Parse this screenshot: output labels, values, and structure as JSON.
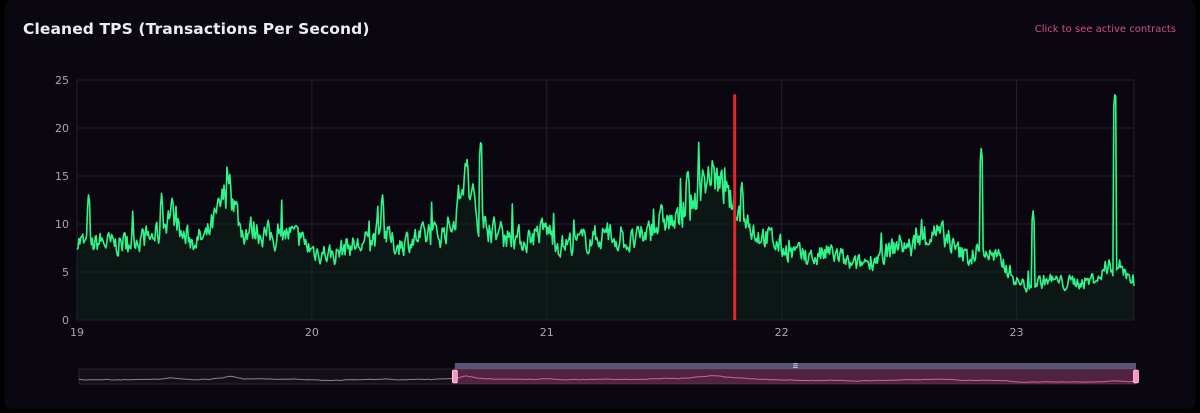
{
  "header": {
    "title": "Cleaned TPS (Transactions Per Second)",
    "link_label": "Click to see active contracts"
  },
  "colors": {
    "background": "#0b0710",
    "line": "#2ef58a",
    "marker": "#e8262a",
    "grid": "#26222c",
    "zoom_selected": "#c04a85",
    "zoom_unselected": "#4a4550",
    "link": "#d24d8f"
  },
  "chart_data": {
    "type": "area",
    "title": "Cleaned TPS (Transactions Per Second)",
    "xlabel": "",
    "ylabel": "",
    "xlim": [
      19,
      23.5
    ],
    "ylim": [
      0,
      25
    ],
    "x_ticks": [
      19,
      20,
      21,
      22,
      23
    ],
    "x_tick_labels": [
      "19",
      "20",
      "21",
      "22",
      "23"
    ],
    "y_ticks": [
      0,
      5,
      10,
      15,
      20,
      25
    ],
    "y_tick_labels": [
      "0",
      "5",
      "10",
      "15",
      "20",
      "25"
    ],
    "grid": true,
    "legend": "none",
    "marker_line": {
      "x": 21.8,
      "y_top": 23.5
    },
    "zoom_window": {
      "start": 20.6,
      "end": 23.5
    },
    "series": [
      {
        "x": [
          19.0,
          19.05,
          19.1,
          19.15,
          19.2,
          19.25,
          19.3,
          19.35,
          19.4,
          19.45,
          19.5,
          19.55,
          19.6,
          19.65,
          19.7,
          19.75,
          19.8,
          19.85,
          19.9,
          19.95,
          20.0,
          20.05,
          20.1,
          20.15,
          20.2,
          20.25,
          20.3,
          20.35,
          20.4,
          20.45,
          20.5,
          20.55,
          20.6,
          20.65,
          20.7,
          20.75,
          20.8,
          20.85,
          20.9,
          20.95,
          21.0,
          21.05,
          21.1,
          21.15,
          21.2,
          21.25,
          21.3,
          21.35,
          21.4,
          21.45,
          21.5,
          21.55,
          21.6,
          21.65,
          21.7,
          21.75,
          21.8,
          21.85,
          21.9,
          21.95,
          22.0,
          22.05,
          22.1,
          22.15,
          22.2,
          22.25,
          22.3,
          22.35,
          22.4,
          22.45,
          22.5,
          22.55,
          22.6,
          22.65,
          22.7,
          22.75,
          22.8,
          22.85,
          22.9,
          22.95,
          23.0,
          23.05,
          23.1,
          23.15,
          23.2,
          23.25,
          23.3,
          23.35,
          23.4,
          23.45,
          23.5
        ],
        "values": [
          8.5,
          7.5,
          8.2,
          7.8,
          8.0,
          8.6,
          8.5,
          9.0,
          11.5,
          8.7,
          8.3,
          8.5,
          11.0,
          14.5,
          9.2,
          9.5,
          9.0,
          8.5,
          9.0,
          8.3,
          7.3,
          7.0,
          6.8,
          7.8,
          7.7,
          8.2,
          9.5,
          7.8,
          8.2,
          8.5,
          8.6,
          9.0,
          10.0,
          15.0,
          11.0,
          9.5,
          9.0,
          8.8,
          8.2,
          9.0,
          9.5,
          7.8,
          8.0,
          8.2,
          8.5,
          9.0,
          8.5,
          8.0,
          8.5,
          9.5,
          10.5,
          10.0,
          11.5,
          13.5,
          15.5,
          13.5,
          11.5,
          10.0,
          9.0,
          8.5,
          7.5,
          7.0,
          6.5,
          6.5,
          7.0,
          6.5,
          5.5,
          6.0,
          6.5,
          7.0,
          8.0,
          7.5,
          8.5,
          9.0,
          8.5,
          7.0,
          6.5,
          7.5,
          6.5,
          5.8,
          4.0,
          3.5,
          4.0,
          4.2,
          3.8,
          4.0,
          4.0,
          4.5,
          5.5,
          5.5,
          4.0
        ],
        "spikes": [
          {
            "x": 19.05,
            "y": 13.3
          },
          {
            "x": 19.36,
            "y": 13.2
          },
          {
            "x": 19.65,
            "y": 15.3
          },
          {
            "x": 20.3,
            "y": 13.3
          },
          {
            "x": 20.66,
            "y": 17.0
          },
          {
            "x": 20.72,
            "y": 19.0
          },
          {
            "x": 21.6,
            "y": 16.0
          },
          {
            "x": 21.83,
            "y": 14.6
          },
          {
            "x": 22.85,
            "y": 18.0
          },
          {
            "x": 23.07,
            "y": 11.5
          },
          {
            "x": 23.42,
            "y": 24.0
          }
        ]
      }
    ]
  }
}
